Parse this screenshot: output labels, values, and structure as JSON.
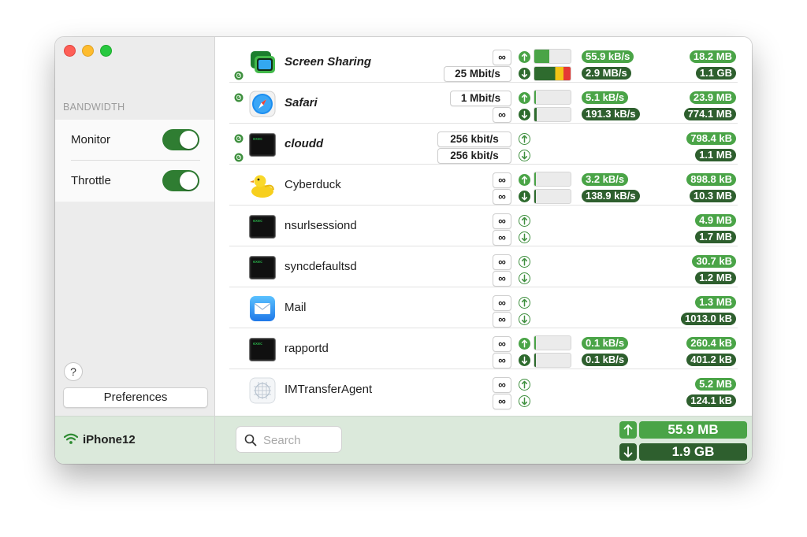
{
  "sidebar": {
    "section_title": "BANDWIDTH",
    "settings": [
      {
        "label": "Monitor",
        "enabled": true
      },
      {
        "label": "Throttle",
        "enabled": true
      }
    ],
    "help_label": "?",
    "preferences_label": "Preferences",
    "device_name": "iPhone12"
  },
  "rows": [
    {
      "name": "Screen Sharing",
      "emphasized": true,
      "icon": "screen-sharing-icon",
      "throttled_up": false,
      "throttled_down": true,
      "up_limit": "∞",
      "down_limit": "25 Mbit/s",
      "up_active": true,
      "down_active": true,
      "up_level": 0.42,
      "down_level": 1.0,
      "up_rate": "55.9 kB/s",
      "down_rate": "2.9 MB/s",
      "up_total": "18.2 MB",
      "down_total": "1.1 GB"
    },
    {
      "name": "Safari",
      "emphasized": true,
      "icon": "safari-icon",
      "throttled_up": true,
      "throttled_down": false,
      "up_limit": "1 Mbit/s",
      "down_limit": "∞",
      "up_active": true,
      "down_active": true,
      "up_level": 0.04,
      "down_level": 0.06,
      "up_rate": "5.1 kB/s",
      "down_rate": "191.3 kB/s",
      "up_total": "23.9 MB",
      "down_total": "774.1 MB"
    },
    {
      "name": "cloudd",
      "emphasized": true,
      "icon": "terminal-exec-icon",
      "throttled_up": true,
      "throttled_down": true,
      "up_limit": "256 kbit/s",
      "down_limit": "256 kbit/s",
      "up_active": false,
      "down_active": false,
      "up_total": "798.4 kB",
      "down_total": "1.1 MB"
    },
    {
      "name": "Cyberduck",
      "emphasized": false,
      "icon": "cyberduck-icon",
      "throttled_up": false,
      "throttled_down": false,
      "up_limit": "∞",
      "down_limit": "∞",
      "up_active": true,
      "down_active": true,
      "up_level": 0.03,
      "down_level": 0.05,
      "up_rate": "3.2 kB/s",
      "down_rate": "138.9 kB/s",
      "up_total": "898.8 kB",
      "down_total": "10.3 MB"
    },
    {
      "name": "nsurlsessiond",
      "emphasized": false,
      "icon": "terminal-exec-icon",
      "throttled_up": false,
      "throttled_down": false,
      "up_limit": "∞",
      "down_limit": "∞",
      "up_active": false,
      "down_active": false,
      "up_total": "4.9 MB",
      "down_total": "1.7 MB"
    },
    {
      "name": "syncdefaultsd",
      "emphasized": false,
      "icon": "terminal-exec-icon",
      "throttled_up": false,
      "throttled_down": false,
      "up_limit": "∞",
      "down_limit": "∞",
      "up_active": false,
      "down_active": false,
      "up_total": "30.7 kB",
      "down_total": "1.2 MB"
    },
    {
      "name": "Mail",
      "emphasized": false,
      "icon": "mail-icon",
      "throttled_up": false,
      "throttled_down": false,
      "up_limit": "∞",
      "down_limit": "∞",
      "up_active": false,
      "down_active": false,
      "up_total": "1.3 MB",
      "down_total": "1013.0 kB"
    },
    {
      "name": "rapportd",
      "emphasized": false,
      "icon": "terminal-exec-icon",
      "throttled_up": false,
      "throttled_down": false,
      "up_limit": "∞",
      "down_limit": "∞",
      "up_active": true,
      "down_active": true,
      "up_level": 0.0,
      "down_level": 0.0,
      "up_rate": "0.1 kB/s",
      "down_rate": "0.1 kB/s",
      "up_total": "260.4 kB",
      "down_total": "401.2 kB"
    },
    {
      "name": "IMTransferAgent",
      "emphasized": false,
      "icon": "imtransferagent-icon",
      "throttled_up": false,
      "throttled_down": false,
      "up_limit": "∞",
      "down_limit": "∞",
      "up_active": false,
      "down_active": false,
      "up_total": "5.2 MB",
      "down_total": "124.1 kB"
    }
  ],
  "footer": {
    "search_placeholder": "Search",
    "total_up": "55.9 MB",
    "total_down": "1.9 GB"
  },
  "colors": {
    "up_green": "#4aa447",
    "down_green": "#2e5f2e",
    "toggle_green": "#2f7d32",
    "footer_bg": "#dbe9db",
    "meter_red": "#e53935",
    "meter_yellow": "#f3c416"
  }
}
